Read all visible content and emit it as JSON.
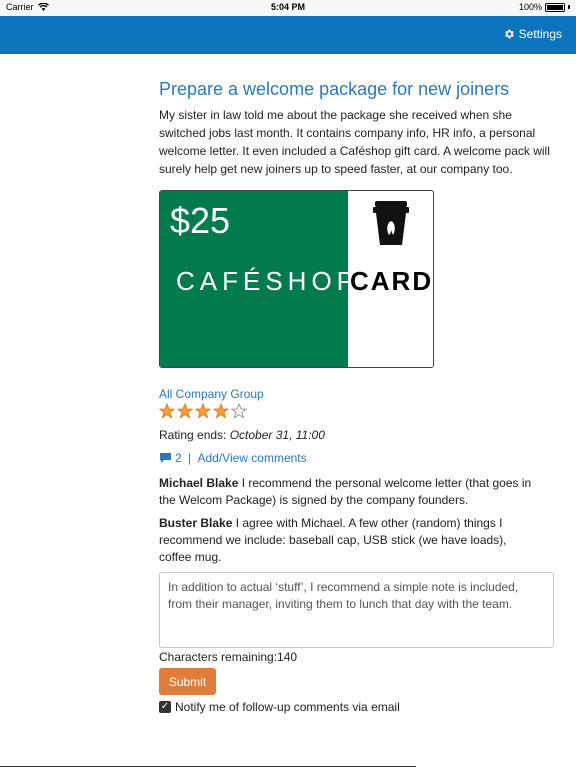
{
  "status_bar": {
    "carrier": "Carrier",
    "time": "5:04 PM",
    "battery": "100%",
    "battery_level": 1.0
  },
  "nav": {
    "settings_label": "Settings",
    "settings_icon": "gear-icon"
  },
  "post": {
    "title": "Prepare a welcome package for new joiners",
    "body": "My sister in law told me about the package she received when she switched jobs last month. It contains company info, HR info, a personal welcome letter. It even included a Caféshop gift card. A welcome pack will surely help get new joiners up to speed faster, at our company too."
  },
  "gift_card": {
    "amount": "$25",
    "brand": "CAFÉSHOP",
    "word": "CARD",
    "green_color": "#017b4d",
    "icon": "coffee-cup-icon"
  },
  "group": {
    "label": "All Company Group"
  },
  "rating": {
    "value": 4,
    "max": 5,
    "ends_label": "Rating ends: ",
    "ends_value": "October 31, 11:00"
  },
  "comments_link": {
    "count": "2",
    "separator": " | ",
    "label": "Add/View comments",
    "icon": "speech-bubble-icon"
  },
  "comments": [
    {
      "author": "Michael Blake",
      "text": " I recommend the personal welcome letter (that goes in the Welcom Package) is signed by the company founders."
    },
    {
      "author": "Buster Blake",
      "text": " I agree with Michael. A few other (random) things I recommend we include: baseball cap, USB stick (we have loads), coffee mug."
    }
  ],
  "comment_input": {
    "value": "In addition to actual ‘stuff’, I recommend a simple note is included, from their manager, inviting them to lunch that day with the team."
  },
  "chars_remaining": "Characters remaining:140",
  "submit_label": "Submit",
  "notify": {
    "label": "Notify me of follow-up comments via email",
    "checked": true
  },
  "colors": {
    "nav_blue": "#0a74bd",
    "link_blue": "#2e78b7",
    "submit_orange": "#e07d3a",
    "star_orange": "#f5a03a"
  }
}
